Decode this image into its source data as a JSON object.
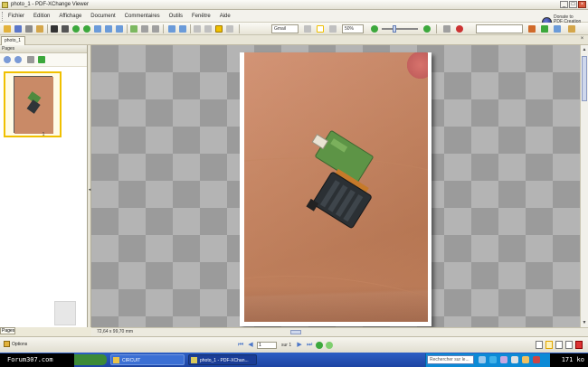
{
  "window": {
    "title": "photo_1 - PDF-XChange Viewer",
    "buttons": [
      "_",
      "□",
      "×"
    ]
  },
  "menu": {
    "items": [
      "Fichier",
      "Edition",
      "Affichage",
      "Document",
      "Commentaires",
      "Outils",
      "Fenêtre",
      "Aide"
    ]
  },
  "brand": {
    "text": "Donate to PDF Creation Tools"
  },
  "toolbar": {
    "zoom_field": "Gmail",
    "zoom_percent": "50%"
  },
  "tabs": {
    "document_tab": "photo_1",
    "close": "×"
  },
  "sidebar": {
    "header": "Pages",
    "thumbnail_label": "1",
    "bottom_tab": "Pages"
  },
  "viewer": {
    "page_size": "72,64 x 99,70 mm"
  },
  "status": {
    "options_label": "Options",
    "page_field": "1",
    "page_of": "sur 1",
    "nav_first": "⏮",
    "nav_prev": "◀",
    "nav_next": "▶",
    "nav_last": "⏭"
  },
  "taskbar": {
    "site": "Forum307.com",
    "tasks": [
      {
        "label": "CIRCUIT"
      },
      {
        "label": "photo_1 - PDF-XChan..."
      },
      {
        "label": "Rechercher sur le..."
      }
    ],
    "search_placeholder": "Rechercher sur le...",
    "bandwidth": "171 ko"
  },
  "colors": {
    "accent": "#f0c000",
    "taskbar": "#1d44a3",
    "close": "#d85a3e"
  }
}
